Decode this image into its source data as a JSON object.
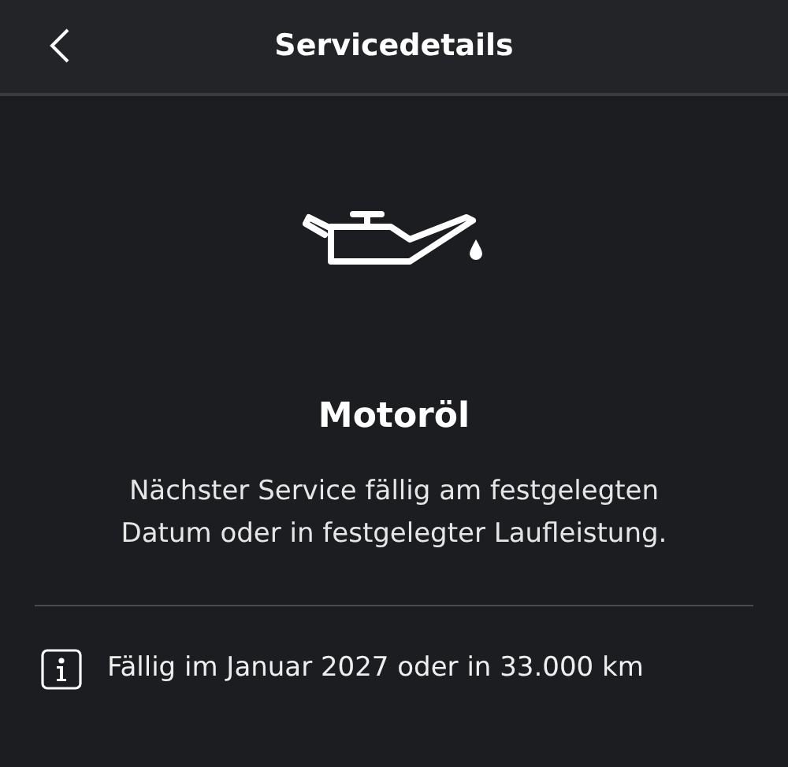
{
  "header": {
    "title": "Servicedetails"
  },
  "service": {
    "title": "Motoröl",
    "description": "Nächster Service fällig am festgelegten Datum oder in festgelegter Laufleistung."
  },
  "info": {
    "text": "Fällig im Januar 2027 oder in 33.000 km"
  }
}
